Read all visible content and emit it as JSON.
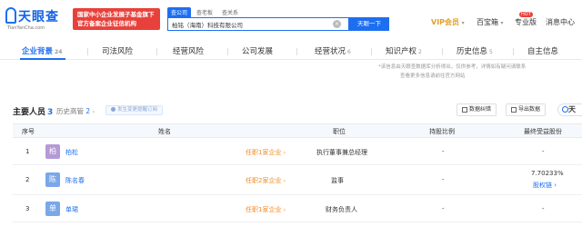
{
  "header": {
    "logo": "天眼查",
    "logo_sub": "TianYanCha.com",
    "promo_line1": "国家中小企业发展子基金旗下",
    "promo_line2": "官方备案企业征信机构",
    "search_tabs": [
      "查公司",
      "查老板",
      "查关系"
    ],
    "search_value": "柏铭（海南）科技有限公司",
    "search_button": "天眼一下",
    "vip": "VIP会员",
    "vip_arrow": "▾",
    "hot_badge": "HOT",
    "baibao": "百宝箱",
    "pro": "专业版",
    "messages": "消息中心"
  },
  "nav_tabs": [
    {
      "label": "企业背景",
      "count": "24"
    },
    {
      "label": "司法风险",
      "count": ""
    },
    {
      "label": "经营风险",
      "count": ""
    },
    {
      "label": "公司发展",
      "count": ""
    },
    {
      "label": "经营状况",
      "count": "6"
    },
    {
      "label": "知识产权",
      "count": "2"
    },
    {
      "label": "历史信息",
      "count": "5"
    },
    {
      "label": "自主信息",
      "count": ""
    }
  ],
  "notice": "*该信息由天眼查数据库分析得出，仅供参考，详情如有疑问请联系",
  "notice2": "查看更多信息请前往官方网站",
  "section": {
    "title": "主要人员",
    "count": "3",
    "history_label": "历史高管",
    "history_count": "2",
    "history_chev": "›",
    "chip": "发生变更提醒订阅",
    "btn_download": "数据纠错",
    "btn_export": "导出数据",
    "side_logo": "天"
  },
  "table": {
    "headers": [
      "序号",
      "姓名",
      "职位",
      "持股比例",
      "最终受益股份"
    ],
    "rows": [
      {
        "index": "1",
        "avatar": "柏",
        "avatar_color": "#b49ad6",
        "name": "柏松",
        "entity": "任职1家企业",
        "position": "执行董事兼总经理",
        "share": "-",
        "benefit": "-",
        "benefit_link": ""
      },
      {
        "index": "2",
        "avatar": "陈",
        "avatar_color": "#7aa7e8",
        "name": "陈名春",
        "entity": "任职2家企业",
        "position": "监事",
        "share": "-",
        "benefit": "7.70233%",
        "benefit_link": "股权链 ›"
      },
      {
        "index": "3",
        "avatar": "单",
        "avatar_color": "#7aa7e8",
        "name": "单珺",
        "entity": "任职1家企业",
        "position": "财务负责人",
        "share": "-",
        "benefit": "-",
        "benefit_link": ""
      }
    ]
  }
}
